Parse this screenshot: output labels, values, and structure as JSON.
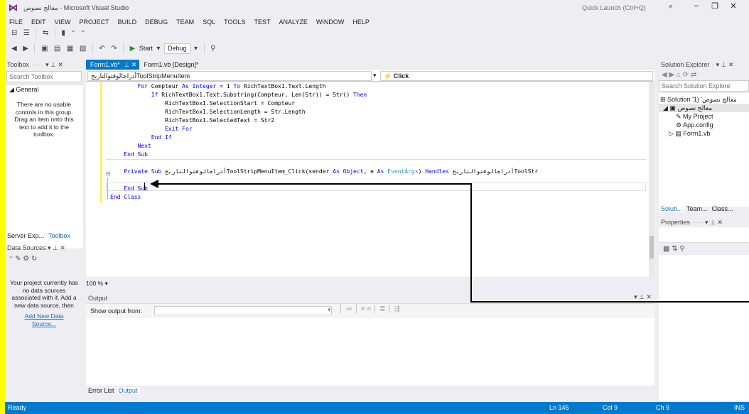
{
  "window": {
    "title": "معالج نصوص - Microsoft Visual Studio",
    "quick_launch": "Quick Launch (Ctrl+Q)"
  },
  "menu": [
    "FILE",
    "EDIT",
    "VIEW",
    "PROJECT",
    "BUILD",
    "DEBUG",
    "TEAM",
    "SQL",
    "TOOLS",
    "TEST",
    "ANALYZE",
    "WINDOW",
    "HELP"
  ],
  "toolbar": {
    "start_label": "Start",
    "config": "Debug"
  },
  "toolbox": {
    "title": "Toolbox",
    "search_placeholder": "Search Toolbox",
    "group": "General",
    "empty_text": "There are no usable controls in this group. Drag an item onto this text to add it to the toolbox.",
    "bottom_tabs": [
      "Server Exp...",
      "Toolbox"
    ]
  },
  "datasources": {
    "title": "Data Sources",
    "text": "Your project currently has no data sources associated with it. Add a new data source, then",
    "link": "Add New Data Source..."
  },
  "editor": {
    "tabs": [
      {
        "label": "Form1.vb*"
      },
      {
        "label": "Form1.vb [Design]*"
      }
    ],
    "member_left": "أدراجالوقتوالتاريخToolStripMenuItem",
    "member_right": "Click",
    "zoom": "100 %",
    "lines": [
      [
        [
          "        ",
          ""
        ],
        [
          "For",
          "kw"
        ],
        [
          " Compteur ",
          ""
        ],
        [
          "As",
          "kw"
        ],
        [
          " ",
          ""
        ],
        [
          "Integer",
          "kw"
        ],
        [
          " = 1 ",
          ""
        ],
        [
          "To",
          "kw"
        ],
        [
          " RichTextBox1.Text.Length",
          ""
        ]
      ],
      [
        [
          "            ",
          ""
        ],
        [
          "If",
          "kw"
        ],
        [
          " RichTextBox1.Text.Substring(Compteur, Len(Str)) = Str() ",
          ""
        ],
        [
          "Then",
          "kw"
        ]
      ],
      [
        [
          "                RichTextBox1.SelectionStart = Compteur",
          ""
        ]
      ],
      [
        [
          "                RichTextBox1.SelectionLength = Str.Length",
          ""
        ]
      ],
      [
        [
          "                RichTextBox1.SelectedText = Str2",
          ""
        ]
      ],
      [
        [
          "                ",
          ""
        ],
        [
          "Exit For",
          "kw"
        ]
      ],
      [
        [
          "            ",
          ""
        ],
        [
          "End If",
          "kw"
        ]
      ],
      [
        [
          "        ",
          ""
        ],
        [
          "Next",
          "kw"
        ]
      ],
      [
        [
          "    ",
          ""
        ],
        [
          "End Sub",
          "kw"
        ]
      ],
      [
        [
          "",
          ""
        ]
      ],
      [
        [
          "    ",
          ""
        ],
        [
          "Private Sub",
          "kw"
        ],
        [
          " أدراجالوقتوالتاريخToolStripMenuItem_Click(sender ",
          ""
        ],
        [
          "As",
          "kw"
        ],
        [
          " ",
          ""
        ],
        [
          "Object",
          "kw"
        ],
        [
          ", e ",
          ""
        ],
        [
          "As",
          "kw"
        ],
        [
          " ",
          ""
        ],
        [
          "EventArgs",
          "ty"
        ],
        [
          ") ",
          ""
        ],
        [
          "Handles",
          "kw"
        ],
        [
          " أدراجالوقتوالتاريخToolStr",
          ""
        ]
      ],
      [
        [
          "",
          ""
        ]
      ],
      [
        [
          "    ",
          ""
        ],
        [
          "End Sub",
          "kw"
        ]
      ],
      [
        [
          "",
          ""
        ],
        [
          "End Class",
          "kw"
        ]
      ]
    ]
  },
  "output": {
    "title": "Output",
    "show_from": "Show output from:",
    "bottom_tabs": [
      "Error List",
      "Output"
    ]
  },
  "solution": {
    "title": "Solution Explorer",
    "search_placeholder": "Search Solution Explore",
    "items": [
      "Solution 'معالج نصوص' (1",
      "معالج نصوص",
      "My Project",
      "App.config",
      "Form1.vb"
    ],
    "tabs": [
      "Soluti...",
      "Team...",
      "Class..."
    ]
  },
  "properties": {
    "title": "Properties"
  },
  "statusbar": {
    "ready": "Ready",
    "ln": "Ln 145",
    "col": "Col 9",
    "ch": "Ch 9",
    "ins": "INS"
  },
  "colors": {
    "accent": "#007acc",
    "page_bg": "#ffff00"
  }
}
